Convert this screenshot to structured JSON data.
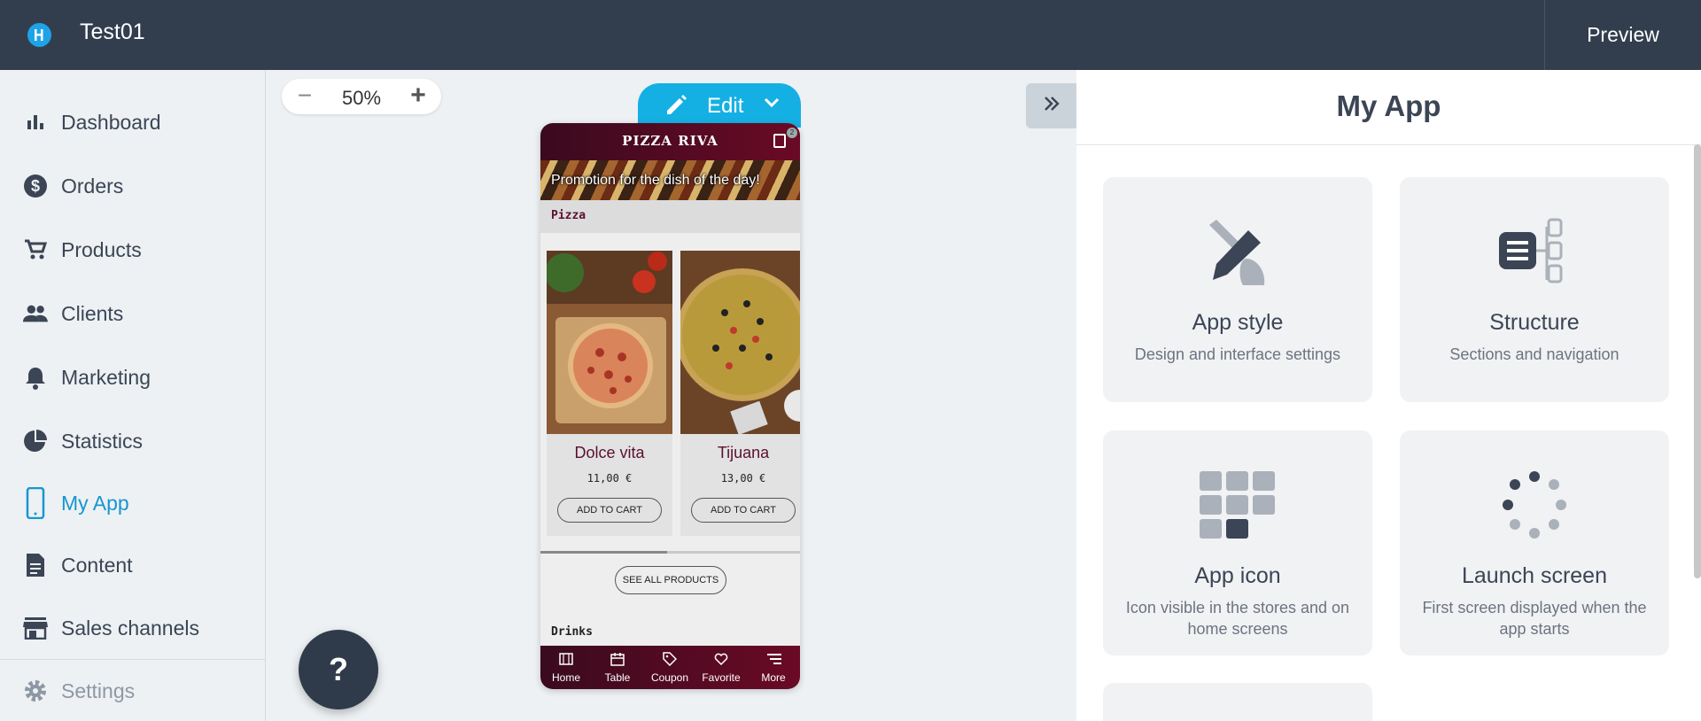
{
  "topbar": {
    "app_title": "Test01",
    "preview_label": "Preview"
  },
  "sidebar": {
    "items": [
      {
        "label": "Dashboard",
        "icon": "bar-chart-icon"
      },
      {
        "label": "Orders",
        "icon": "dollar-circle-icon"
      },
      {
        "label": "Products",
        "icon": "cart-icon"
      },
      {
        "label": "Clients",
        "icon": "people-icon"
      },
      {
        "label": "Marketing",
        "icon": "bell-icon"
      },
      {
        "label": "Statistics",
        "icon": "pie-chart-icon"
      },
      {
        "label": "My App",
        "icon": "phone-icon",
        "active": true
      },
      {
        "label": "Content",
        "icon": "document-icon"
      },
      {
        "label": "Sales channels",
        "icon": "store-icon"
      }
    ],
    "settings_label": "Settings"
  },
  "zoom": {
    "value": "50%"
  },
  "help": {
    "label": "?"
  },
  "edit": {
    "label": "Edit"
  },
  "phone": {
    "title": "PIZZA RIVA",
    "cart_count": "2",
    "banner": "Promotion for the dish of the day!",
    "section": "Pizza",
    "products": [
      {
        "name": "Dolce vita",
        "price": "11,00 €",
        "button": "ADD TO CART"
      },
      {
        "name": "Tijuana",
        "price": "13,00 €",
        "button": "ADD TO CART"
      }
    ],
    "see_all": "SEE ALL PRODUCTS",
    "next_section": "Drinks",
    "tabs": [
      {
        "label": "Home"
      },
      {
        "label": "Table"
      },
      {
        "label": "Coupon"
      },
      {
        "label": "Favorite"
      },
      {
        "label": "More"
      }
    ]
  },
  "panel": {
    "title": "My App",
    "tiles": [
      {
        "title": "App style",
        "desc": "Design and interface settings"
      },
      {
        "title": "Structure",
        "desc": "Sections and navigation"
      },
      {
        "title": "App icon",
        "desc": "Icon visible in the stores and on home screens"
      },
      {
        "title": "Launch screen",
        "desc": "First screen displayed when the app starts"
      }
    ]
  },
  "colors": {
    "topbar": "#323e4e",
    "accent": "#1796d0",
    "edit": "#15b0e3",
    "phone_brand": "#5a1030"
  }
}
